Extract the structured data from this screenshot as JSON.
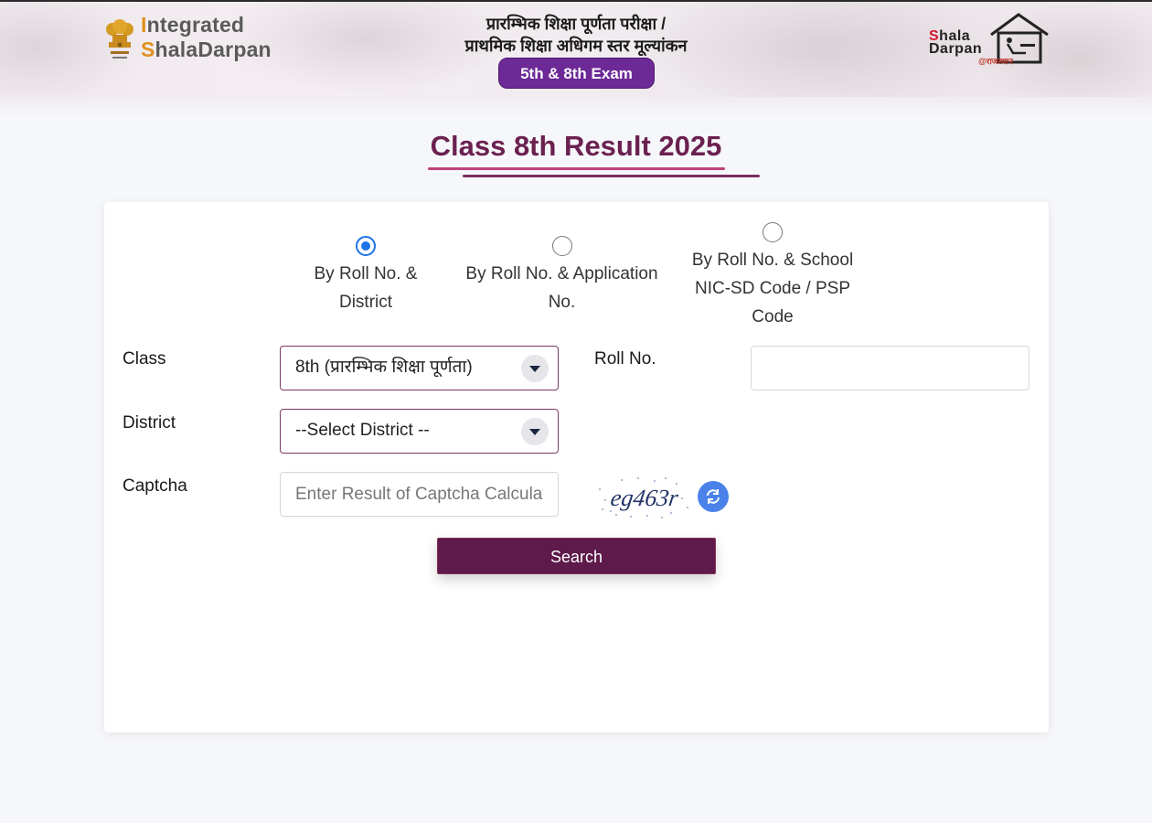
{
  "header": {
    "brand_line1_first": "I",
    "brand_line1_rest": "ntegrated",
    "brand_line2_first": "S",
    "brand_line2_rest": "halaDarpan",
    "hindi_line1": "प्रारम्भिक शिक्षा पूर्णता परीक्षा /",
    "hindi_line2": "प्राथमिक शिक्षा अधिगम स्तर मूल्यांकन",
    "exam_badge": "5th & 8th Exam",
    "right_logo_line1_first": "S",
    "right_logo_line1_rest": "hala",
    "right_logo_line2": "Darpan",
    "right_logo_sub": "@राजस्थान"
  },
  "page": {
    "title": "Class 8th Result 2025"
  },
  "search_mode": {
    "options": [
      {
        "label": "By Roll No. & District",
        "selected": true
      },
      {
        "label": "By Roll No. & Application No.",
        "selected": false
      },
      {
        "label": "By Roll No. & School NIC-SD Code / PSP Code",
        "selected": false
      }
    ]
  },
  "form": {
    "class_label": "Class",
    "class_value": "8th (प्रारम्भिक शिक्षा पूर्णता)",
    "roll_label": "Roll No.",
    "roll_value": "",
    "district_label": "District",
    "district_value": "--Select District --",
    "captcha_label": "Captcha",
    "captcha_placeholder": "Enter Result of Captcha Calculation",
    "captcha_text": "eg463r",
    "search_label": "Search"
  },
  "colors": {
    "accent": "#6b2150",
    "button": "#5d1a4b",
    "radio": "#1e73e8",
    "badge": "#6d2a97"
  }
}
